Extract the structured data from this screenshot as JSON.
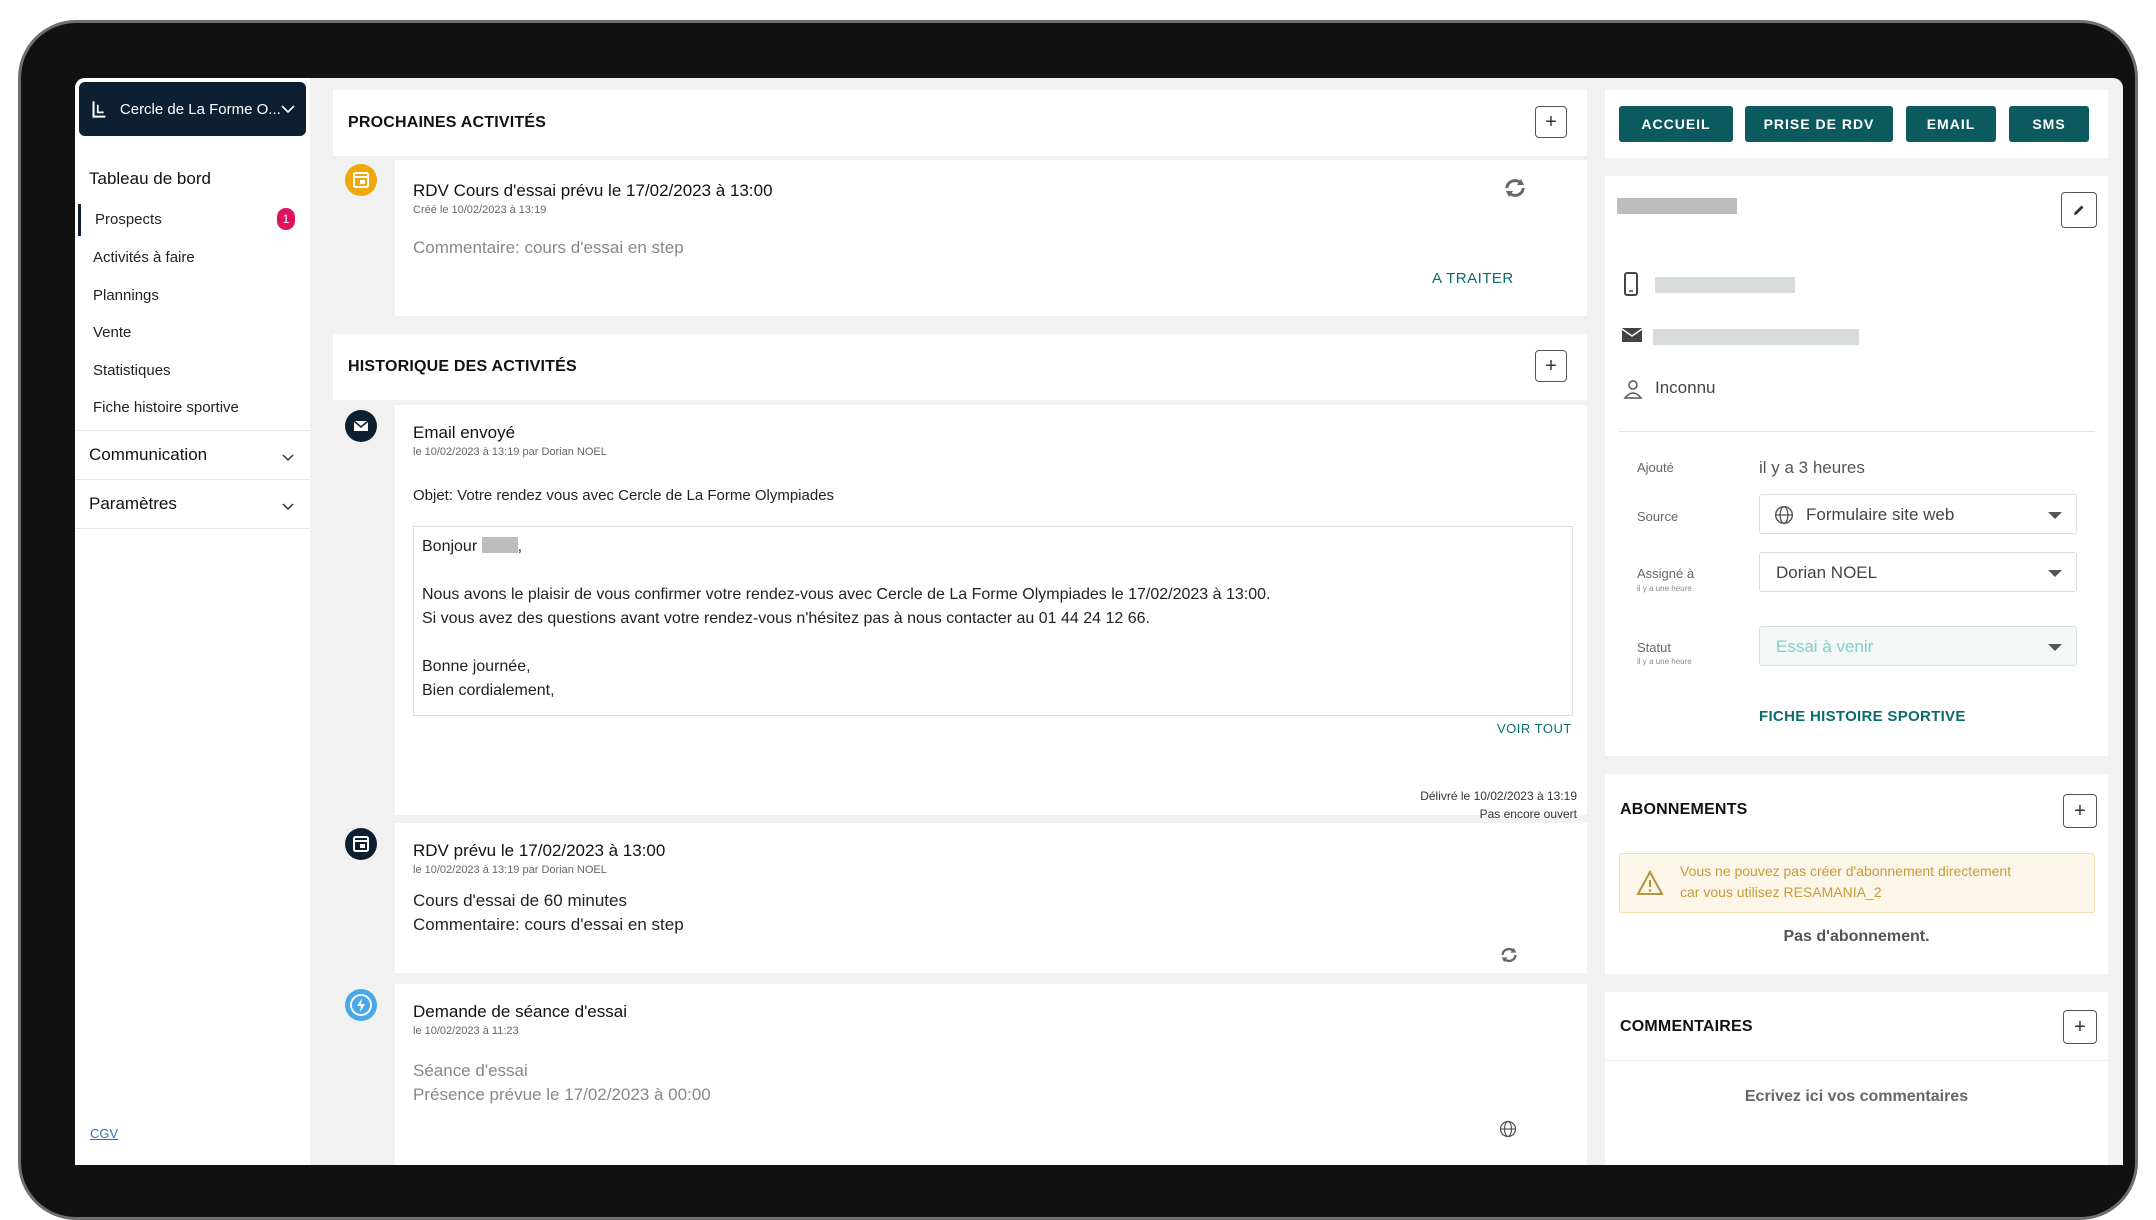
{
  "sidebar": {
    "org_name": "Cercle de La Forme O...",
    "main_item": "Tableau de bord",
    "items": [
      {
        "label": "Prospects",
        "badge": "1"
      },
      {
        "label": "Activités à faire"
      },
      {
        "label": "Plannings"
      },
      {
        "label": "Vente"
      },
      {
        "label": "Statistiques"
      },
      {
        "label": "Fiche histoire sportive"
      }
    ],
    "sections": [
      {
        "label": "Communication"
      },
      {
        "label": "Paramètres"
      }
    ],
    "footer_link": "CGV"
  },
  "upcoming": {
    "title": "PROCHAINES ACTIVITÉS",
    "add_label": "+",
    "item": {
      "title": "RDV Cours d'essai prévu le 17/02/2023 à 13:00",
      "meta": "Créé le 10/02/2023 à 13:19",
      "comment": "Commentaire: cours d'essai en step",
      "action": "A TRAITER"
    }
  },
  "history": {
    "title": "HISTORIQUE DES ACTIVITÉS",
    "add_label": "+",
    "email": {
      "title": "Email envoyé",
      "meta": "le 10/02/2023 à 13:19 par Dorian NOEL",
      "subject": "Objet: Votre rendez vous avec Cercle de La Forme Olympiades",
      "greeting": "Bonjour",
      "line1": "Nous avons le plaisir de vous confirmer votre rendez-vous avec Cercle de La Forme Olympiades  le 17/02/2023 à 13:00.",
      "line2": "Si vous avez des questions avant votre rendez-vous n'hésitez pas à nous contacter au 01 44 24 12 66.",
      "closing1": "Bonne journée,",
      "closing2": "Bien cordialement,",
      "see_all": "VOIR TOUT",
      "delivered": "Délivré le 10/02/2023 à 13:19",
      "opened": "Pas encore ouvert"
    },
    "rdv": {
      "title": "RDV prévu le 17/02/2023 à 13:00",
      "meta": "le 10/02/2023 à 13:19 par Dorian NOEL",
      "line1": "Cours d'essai de 60 minutes",
      "line2": "Commentaire: cours d'essai en step"
    },
    "request": {
      "title": "Demande de séance d'essai",
      "meta": "le 10/02/2023 à 11:23",
      "line1": "Séance d'essai",
      "line2": "Présence prévue le 17/02/2023 à 00:00"
    }
  },
  "actions": {
    "accueil": "ACCUEIL",
    "rdv": "PRISE DE RDV",
    "email": "EMAIL",
    "sms": "SMS"
  },
  "contact": {
    "gender": "Inconnu",
    "added_label": "Ajouté",
    "added_value": "il y a 3 heures",
    "source_label": "Source",
    "source_value": "Formulaire site web",
    "assigned_label": "Assigné à",
    "assigned_sub": "il y a une heure",
    "assigned_value": "Dorian NOEL",
    "status_label": "Statut",
    "status_sub": "il y a une heure",
    "status_value": "Essai à venir",
    "fiche_link": "FICHE HISTOIRE SPORTIVE"
  },
  "subscriptions": {
    "title": "ABONNEMENTS",
    "warning_line1": "Vous ne pouvez pas créer d'abonnement directement",
    "warning_line2": "car vous utilisez RESAMANIA_2",
    "empty": "Pas d'abonnement."
  },
  "comments": {
    "title": "COMMENTAIRES",
    "placeholder": "Ecrivez ici vos commentaires"
  },
  "colors": {
    "accent": "#0b5a60",
    "sidebar_dark": "#0d1f30",
    "badge": "#e0115f",
    "calendar_orange": "#f0a70a",
    "request_blue": "#4aa8e8",
    "status_text": "#7fcfc8"
  }
}
